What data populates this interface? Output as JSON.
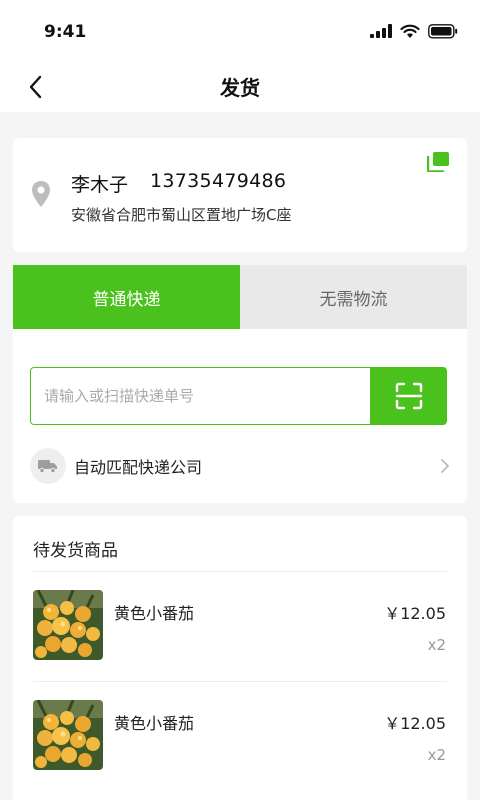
{
  "status_bar": {
    "time": "9:41"
  },
  "nav": {
    "title": "发货"
  },
  "address": {
    "name": "李木子",
    "phone": "13735479486",
    "detail": "安徽省合肥市蜀山区置地广场C座"
  },
  "shipping": {
    "tabs": [
      {
        "label": "普通快递",
        "active": true
      },
      {
        "label": "无需物流",
        "active": false
      }
    ],
    "tracking_placeholder": "请输入或扫描快递单号",
    "auto_match_label": "自动匹配快递公司"
  },
  "goods": {
    "title": "待发货商品",
    "items": [
      {
        "name": "黄色小番茄",
        "price": "￥12.05",
        "qty": "x2"
      },
      {
        "name": "黄色小番茄",
        "price": "￥12.05",
        "qty": "x2"
      }
    ]
  },
  "colors": {
    "accent": "#4ac11d",
    "tab_inactive_bg": "#e9e9e9",
    "page_bg": "#f5f5f5"
  },
  "icons": [
    "back-arrow-icon",
    "location-pin-icon",
    "copy-icon",
    "scan-icon",
    "truck-icon",
    "chevron-right-icon"
  ]
}
